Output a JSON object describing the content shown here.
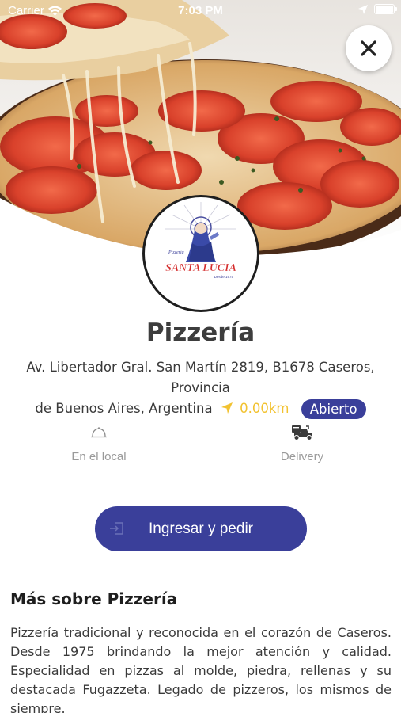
{
  "status_bar": {
    "carrier": "Carrier",
    "time": "7:03 PM"
  },
  "hero": {
    "image": "pizza-photo",
    "close_icon": "close-icon"
  },
  "logo": {
    "top_text": "Pizzería",
    "name": "SANTA LUCIA",
    "since": "Desde 1975"
  },
  "restaurant": {
    "name": "Pizzería",
    "address_line1": "Av. Libertador Gral. San Martín 2819, B1678 Caseros, Provincia",
    "address_line2": "de Buenos Aires, Argentina",
    "distance": "0.00km",
    "status": "Abierto"
  },
  "options": {
    "local_label": "En el local",
    "local_icon": "dine-in-icon",
    "delivery_label": "Delivery",
    "delivery_icon": "delivery-scooter-icon"
  },
  "cta": {
    "label": "Ingresar y pedir",
    "icon": "login-icon"
  },
  "about": {
    "title": "Más sobre Pizzería",
    "text": "Pizzería tradicional y reconocida en el corazón de Caseros. Desde 1975 brindando la mejor atención y calidad. Especialidad en pizzas al molde, piedra, rellenas y su destacada Fugazzeta. Legado de pizzeros, los mismos de siempre."
  },
  "colors": {
    "accent": "#3a3f9a",
    "distance": "#f2c230",
    "muted": "#9a9a9a"
  }
}
